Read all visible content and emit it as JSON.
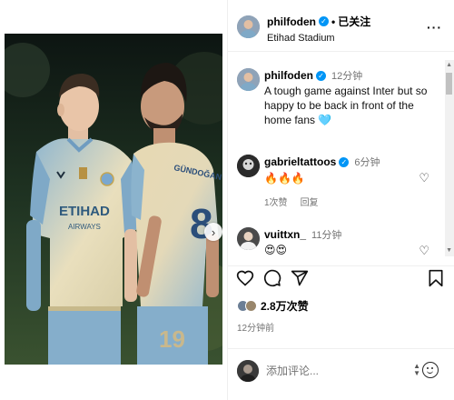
{
  "post": {
    "photo_description_icon": "person-icon",
    "carousel_dots": 6,
    "carousel_active": 1
  },
  "header": {
    "username": "philfoden",
    "follow_status": "已关注",
    "location": "Etihad Stadium",
    "separator": "•",
    "more_icon": "more-horizontal-icon"
  },
  "caption": {
    "username": "philfoden",
    "time": "12分钟",
    "text": "A tough game against Inter but so happy to be back in front of the home fans 🩵"
  },
  "comments": [
    {
      "username": "gabrieltattoos",
      "time": "6分钟",
      "text": "🔥🔥🔥",
      "likes": "1次赞",
      "reply": "回复"
    },
    {
      "username": "vuittxn_",
      "time": "11分钟",
      "text": "😍😍"
    }
  ],
  "actions": {
    "like_icon": "heart-icon",
    "comment_icon": "comment-icon",
    "share_icon": "send-icon",
    "save_icon": "bookmark-icon"
  },
  "likes": {
    "count_text": "2.8万次赞"
  },
  "posted_time": "12分钟前",
  "composer": {
    "placeholder": "添加评论..."
  },
  "colors": {
    "verified": "#0095f6",
    "muted_text": "#737373",
    "divider": "#efefef"
  }
}
